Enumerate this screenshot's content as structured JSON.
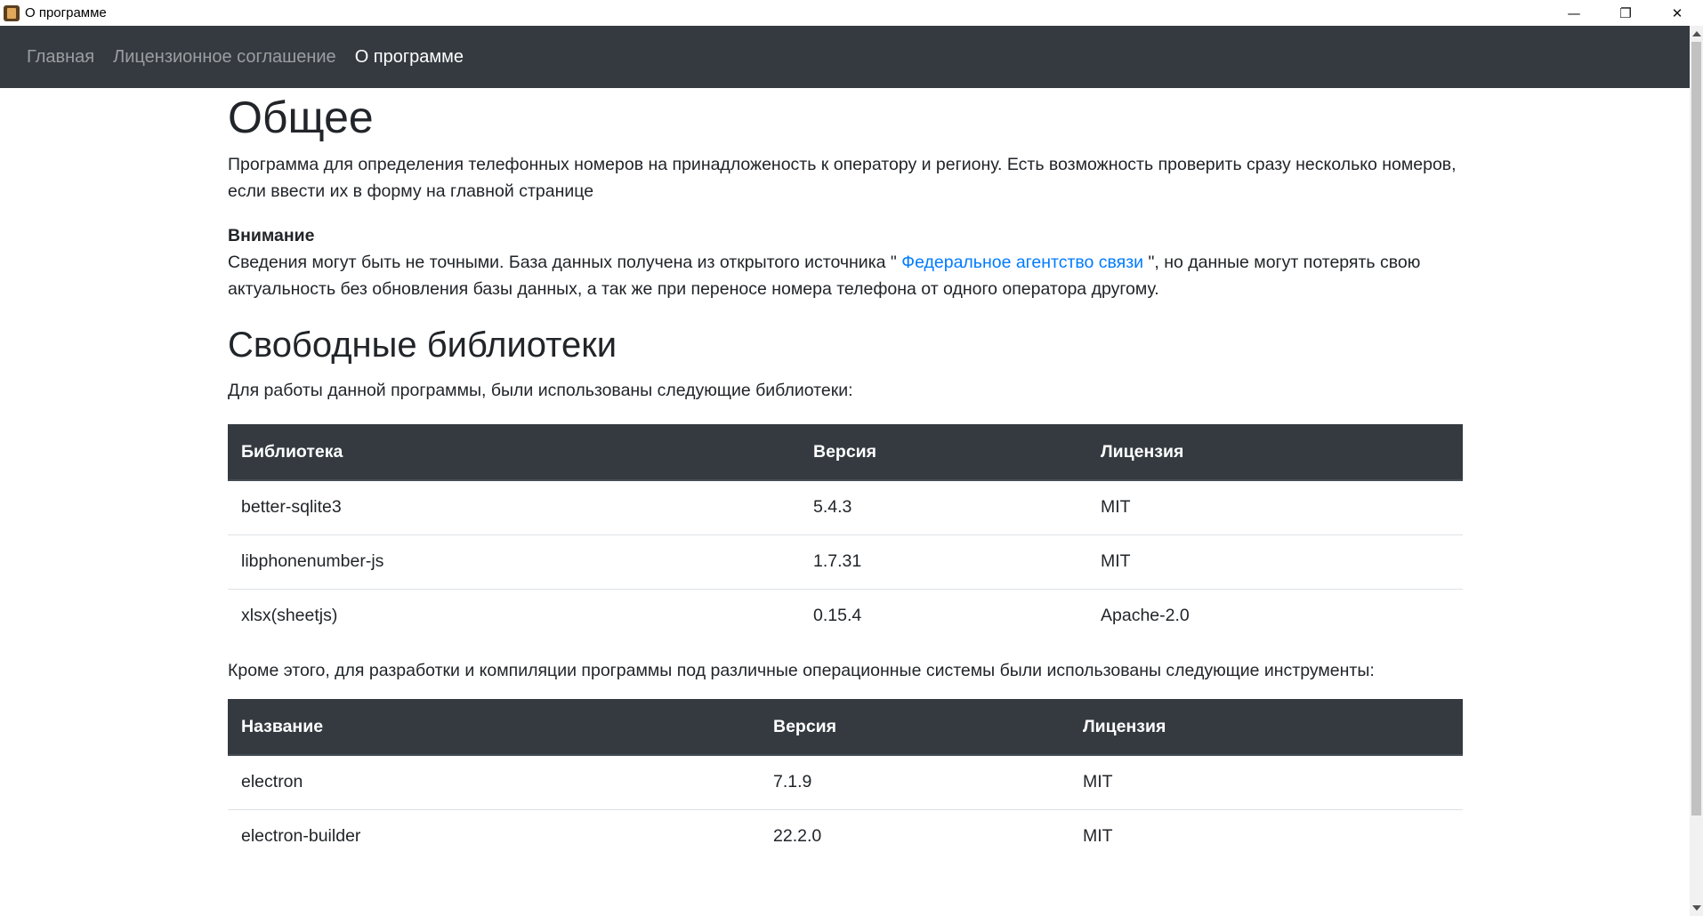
{
  "window": {
    "title": "О программе",
    "minimize": "—",
    "maximize": "❐",
    "close": "✕"
  },
  "nav": {
    "items": [
      {
        "label": "Главная"
      },
      {
        "label": "Лицензионное соглашение"
      },
      {
        "label": "О программе"
      }
    ]
  },
  "general": {
    "heading": "Общее",
    "description": "Программа для определения телефонных номеров на принадложеность к оператору и региону. Есть возможность проверить сразу несколько номеров, если ввести их в форму на главной странице",
    "warning_title": "Внимание",
    "warning_text_before": "Сведения могут быть не точными. База данных получена из открытого источника \" ",
    "warning_link": "Федеральное агентство связи",
    "warning_text_after": " \", но данные могут потерять свою актуальность без обновления базы данных, а так же при переносе номера телефона от одного оператора другому."
  },
  "libraries": {
    "heading": "Свободные библиотеки",
    "intro": "Для работы данной программы, были использованы следующие библиотеки:",
    "columns": [
      "Библиотека",
      "Версия",
      "Лицензия"
    ],
    "rows": [
      [
        "better-sqlite3",
        "5.4.3",
        "MIT"
      ],
      [
        "libphonenumber-js",
        "1.7.31",
        "MIT"
      ],
      [
        "xlsx(sheetjs)",
        "0.15.4",
        "Apache-2.0"
      ]
    ]
  },
  "tools": {
    "intro": "Кроме этого, для разработки и компиляции программы под различные операционные системы были использованы следующие инструменты:",
    "columns": [
      "Название",
      "Версия",
      "Лицензия"
    ],
    "rows": [
      [
        "electron",
        "7.1.9",
        "MIT"
      ],
      [
        "electron-builder",
        "22.2.0",
        "MIT"
      ]
    ]
  }
}
